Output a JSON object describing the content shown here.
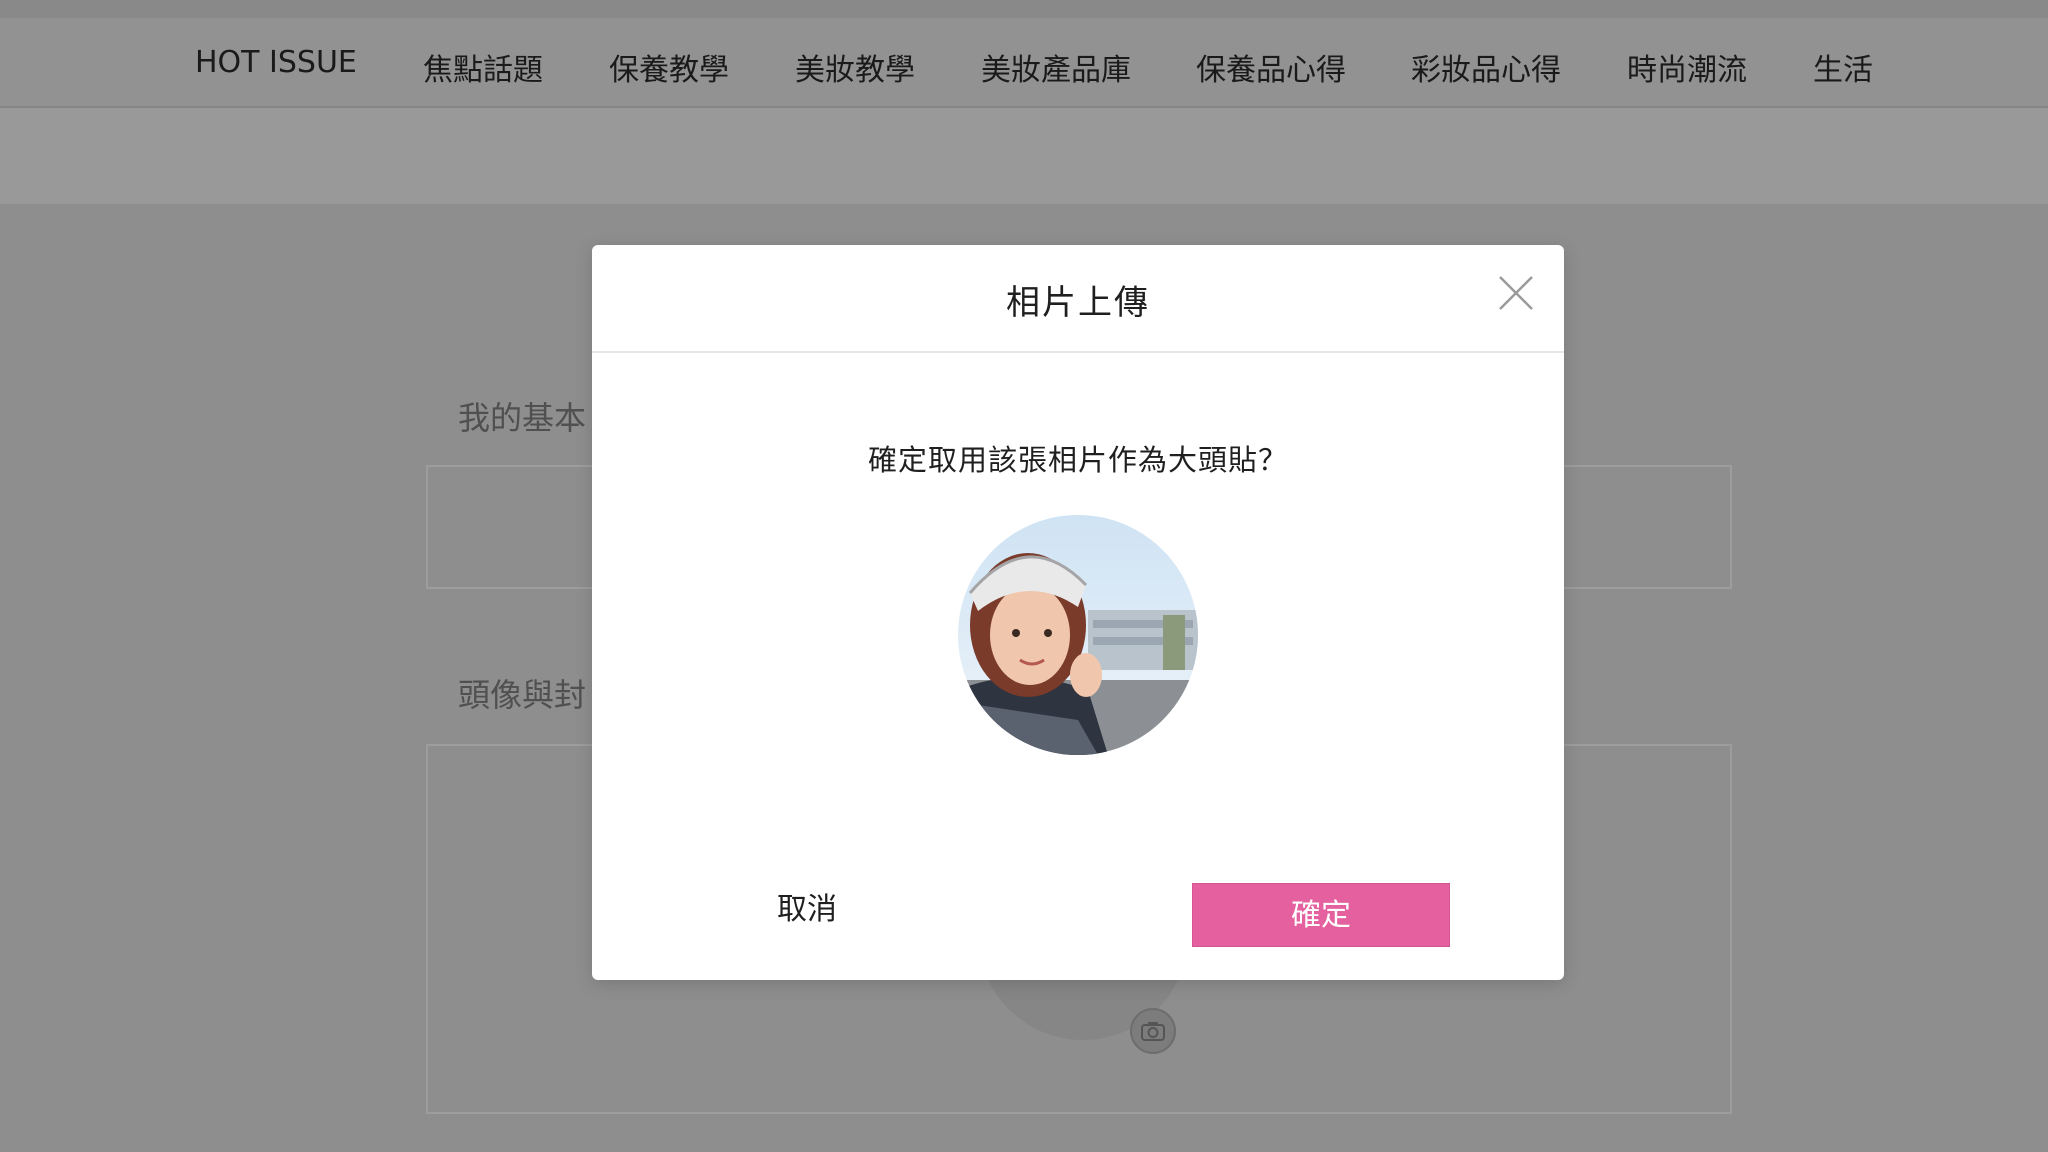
{
  "nav": {
    "items": [
      {
        "label": "HOT ISSUE"
      },
      {
        "label": "焦點話題"
      },
      {
        "label": "保養教學"
      },
      {
        "label": "美妝教學"
      },
      {
        "label": "美妝產品庫"
      },
      {
        "label": "保養品心得"
      },
      {
        "label": "彩妝品心得"
      },
      {
        "label": "時尚潮流"
      },
      {
        "label": "生活"
      }
    ]
  },
  "background": {
    "section_basic": "我的基本",
    "section_avatar": "頭像與封"
  },
  "modal": {
    "title": "相片上傳",
    "question": "確定取用該張相片作為大頭貼？",
    "cancel_label": "取消",
    "confirm_label": "確定"
  },
  "icons": {
    "close": "close-icon",
    "camera": "camera-icon"
  },
  "colors": {
    "accent": "#e4609f",
    "overlay": "#8f8e8f",
    "modal_bg": "#ffffff"
  }
}
